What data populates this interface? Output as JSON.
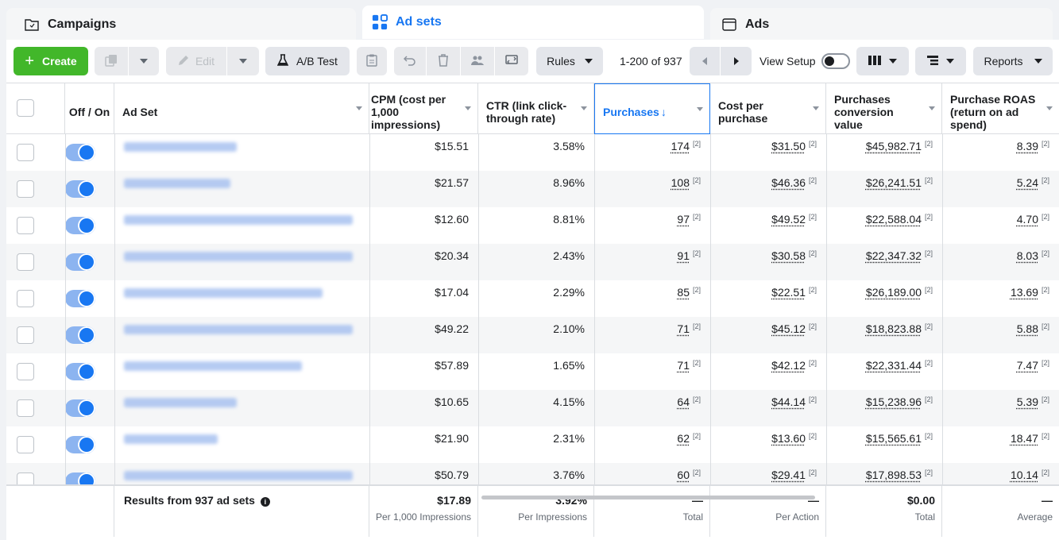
{
  "tabs": [
    {
      "label": "Campaigns",
      "icon": "folder-icon"
    },
    {
      "label": "Ad sets",
      "icon": "grid-icon"
    },
    {
      "label": "Ads",
      "icon": "window-icon"
    }
  ],
  "toolbar": {
    "create_label": "Create",
    "edit_label": "Edit",
    "ab_test_label": "A/B Test",
    "rules_label": "Rules",
    "pager_text": "1-200 of 937",
    "view_setup_label": "View Setup",
    "reports_label": "Reports"
  },
  "columns": {
    "off_on": "Off / On",
    "ad_set": "Ad Set",
    "cpm": "CPM (cost per 1,000 impressions)",
    "ctr": "CTR (link click-through rate)",
    "purchases": "Purchases",
    "cost_per_purchase": "Cost per purchase",
    "conv_value": "Purchases conversion value",
    "roas": "Purchase ROAS (return on ad spend)"
  },
  "sup_mark": "[2]",
  "rows": [
    {
      "cpm": "$15.51",
      "ctr": "3.58%",
      "purchases": "174",
      "cpp": "$31.50",
      "value": "$45,982.71",
      "roas": "8.39"
    },
    {
      "cpm": "$21.57",
      "ctr": "8.96%",
      "purchases": "108",
      "cpp": "$46.36",
      "value": "$26,241.51",
      "roas": "5.24"
    },
    {
      "cpm": "$12.60",
      "ctr": "8.81%",
      "purchases": "97",
      "cpp": "$49.52",
      "value": "$22,588.04",
      "roas": "4.70"
    },
    {
      "cpm": "$20.34",
      "ctr": "2.43%",
      "purchases": "91",
      "cpp": "$30.58",
      "value": "$22,347.32",
      "roas": "8.03"
    },
    {
      "cpm": "$17.04",
      "ctr": "2.29%",
      "purchases": "85",
      "cpp": "$22.51",
      "value": "$26,189.00",
      "roas": "13.69"
    },
    {
      "cpm": "$49.22",
      "ctr": "2.10%",
      "purchases": "71",
      "cpp": "$45.12",
      "value": "$18,823.88",
      "roas": "5.88"
    },
    {
      "cpm": "$57.89",
      "ctr": "1.65%",
      "purchases": "71",
      "cpp": "$42.12",
      "value": "$22,331.44",
      "roas": "7.47"
    },
    {
      "cpm": "$10.65",
      "ctr": "4.15%",
      "purchases": "64",
      "cpp": "$44.14",
      "value": "$15,238.96",
      "roas": "5.39"
    },
    {
      "cpm": "$21.90",
      "ctr": "2.31%",
      "purchases": "62",
      "cpp": "$13.60",
      "value": "$15,565.61",
      "roas": "18.47"
    },
    {
      "cpm": "$50.79",
      "ctr": "3.76%",
      "purchases": "60",
      "cpp": "$29.41",
      "value": "$17,898.53",
      "roas": "10.14"
    }
  ],
  "footer": {
    "results_label": "Results from 937 ad sets",
    "cpm": "$17.89",
    "cpm_sub": "Per 1,000 Impressions",
    "ctr": "3.92%",
    "ctr_sub": "Per Impressions",
    "purchases": "—",
    "purchases_sub": "Total",
    "cpp": "—",
    "cpp_sub": "Per Action",
    "value": "$0.00",
    "value_sub": "Total",
    "roas": "—",
    "roas_sub": "Average"
  },
  "colors": {
    "accent": "#1877f2",
    "create": "#42b72a"
  }
}
